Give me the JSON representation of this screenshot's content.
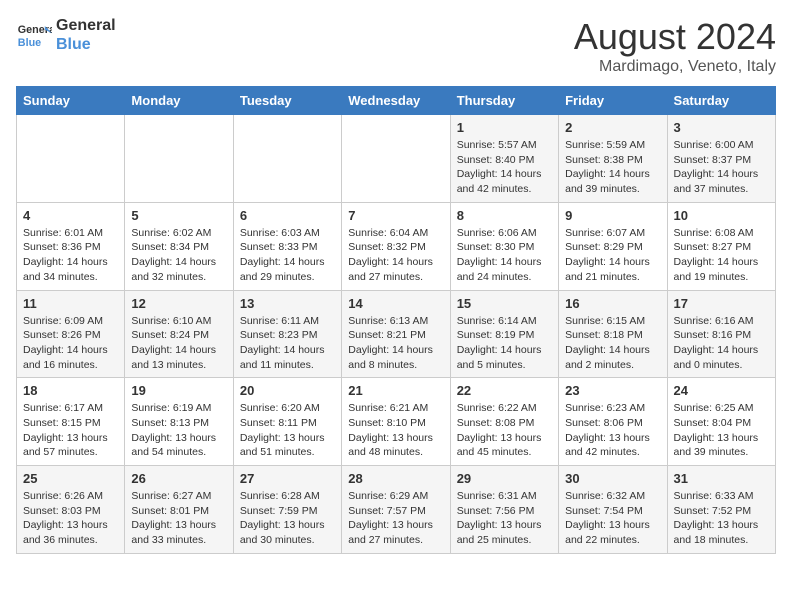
{
  "logo": {
    "line1": "General",
    "line2": "Blue"
  },
  "title": "August 2024",
  "subtitle": "Mardimago, Veneto, Italy",
  "days_of_week": [
    "Sunday",
    "Monday",
    "Tuesday",
    "Wednesday",
    "Thursday",
    "Friday",
    "Saturday"
  ],
  "weeks": [
    [
      {
        "day": "",
        "info": ""
      },
      {
        "day": "",
        "info": ""
      },
      {
        "day": "",
        "info": ""
      },
      {
        "day": "",
        "info": ""
      },
      {
        "day": "1",
        "info": "Sunrise: 5:57 AM\nSunset: 8:40 PM\nDaylight: 14 hours and 42 minutes."
      },
      {
        "day": "2",
        "info": "Sunrise: 5:59 AM\nSunset: 8:38 PM\nDaylight: 14 hours and 39 minutes."
      },
      {
        "day": "3",
        "info": "Sunrise: 6:00 AM\nSunset: 8:37 PM\nDaylight: 14 hours and 37 minutes."
      }
    ],
    [
      {
        "day": "4",
        "info": "Sunrise: 6:01 AM\nSunset: 8:36 PM\nDaylight: 14 hours and 34 minutes."
      },
      {
        "day": "5",
        "info": "Sunrise: 6:02 AM\nSunset: 8:34 PM\nDaylight: 14 hours and 32 minutes."
      },
      {
        "day": "6",
        "info": "Sunrise: 6:03 AM\nSunset: 8:33 PM\nDaylight: 14 hours and 29 minutes."
      },
      {
        "day": "7",
        "info": "Sunrise: 6:04 AM\nSunset: 8:32 PM\nDaylight: 14 hours and 27 minutes."
      },
      {
        "day": "8",
        "info": "Sunrise: 6:06 AM\nSunset: 8:30 PM\nDaylight: 14 hours and 24 minutes."
      },
      {
        "day": "9",
        "info": "Sunrise: 6:07 AM\nSunset: 8:29 PM\nDaylight: 14 hours and 21 minutes."
      },
      {
        "day": "10",
        "info": "Sunrise: 6:08 AM\nSunset: 8:27 PM\nDaylight: 14 hours and 19 minutes."
      }
    ],
    [
      {
        "day": "11",
        "info": "Sunrise: 6:09 AM\nSunset: 8:26 PM\nDaylight: 14 hours and 16 minutes."
      },
      {
        "day": "12",
        "info": "Sunrise: 6:10 AM\nSunset: 8:24 PM\nDaylight: 14 hours and 13 minutes."
      },
      {
        "day": "13",
        "info": "Sunrise: 6:11 AM\nSunset: 8:23 PM\nDaylight: 14 hours and 11 minutes."
      },
      {
        "day": "14",
        "info": "Sunrise: 6:13 AM\nSunset: 8:21 PM\nDaylight: 14 hours and 8 minutes."
      },
      {
        "day": "15",
        "info": "Sunrise: 6:14 AM\nSunset: 8:19 PM\nDaylight: 14 hours and 5 minutes."
      },
      {
        "day": "16",
        "info": "Sunrise: 6:15 AM\nSunset: 8:18 PM\nDaylight: 14 hours and 2 minutes."
      },
      {
        "day": "17",
        "info": "Sunrise: 6:16 AM\nSunset: 8:16 PM\nDaylight: 14 hours and 0 minutes."
      }
    ],
    [
      {
        "day": "18",
        "info": "Sunrise: 6:17 AM\nSunset: 8:15 PM\nDaylight: 13 hours and 57 minutes."
      },
      {
        "day": "19",
        "info": "Sunrise: 6:19 AM\nSunset: 8:13 PM\nDaylight: 13 hours and 54 minutes."
      },
      {
        "day": "20",
        "info": "Sunrise: 6:20 AM\nSunset: 8:11 PM\nDaylight: 13 hours and 51 minutes."
      },
      {
        "day": "21",
        "info": "Sunrise: 6:21 AM\nSunset: 8:10 PM\nDaylight: 13 hours and 48 minutes."
      },
      {
        "day": "22",
        "info": "Sunrise: 6:22 AM\nSunset: 8:08 PM\nDaylight: 13 hours and 45 minutes."
      },
      {
        "day": "23",
        "info": "Sunrise: 6:23 AM\nSunset: 8:06 PM\nDaylight: 13 hours and 42 minutes."
      },
      {
        "day": "24",
        "info": "Sunrise: 6:25 AM\nSunset: 8:04 PM\nDaylight: 13 hours and 39 minutes."
      }
    ],
    [
      {
        "day": "25",
        "info": "Sunrise: 6:26 AM\nSunset: 8:03 PM\nDaylight: 13 hours and 36 minutes."
      },
      {
        "day": "26",
        "info": "Sunrise: 6:27 AM\nSunset: 8:01 PM\nDaylight: 13 hours and 33 minutes."
      },
      {
        "day": "27",
        "info": "Sunrise: 6:28 AM\nSunset: 7:59 PM\nDaylight: 13 hours and 30 minutes."
      },
      {
        "day": "28",
        "info": "Sunrise: 6:29 AM\nSunset: 7:57 PM\nDaylight: 13 hours and 27 minutes."
      },
      {
        "day": "29",
        "info": "Sunrise: 6:31 AM\nSunset: 7:56 PM\nDaylight: 13 hours and 25 minutes."
      },
      {
        "day": "30",
        "info": "Sunrise: 6:32 AM\nSunset: 7:54 PM\nDaylight: 13 hours and 22 minutes."
      },
      {
        "day": "31",
        "info": "Sunrise: 6:33 AM\nSunset: 7:52 PM\nDaylight: 13 hours and 18 minutes."
      }
    ]
  ]
}
